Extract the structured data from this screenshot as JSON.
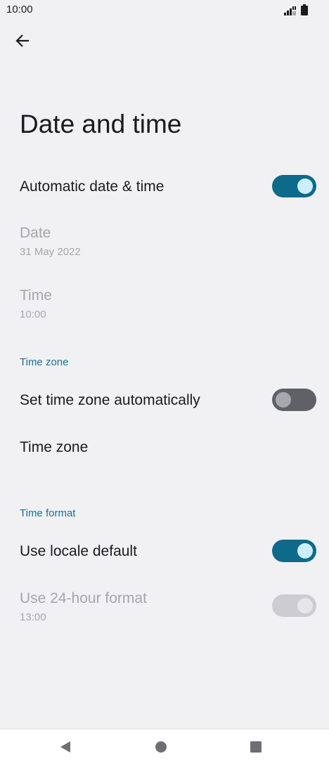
{
  "status_bar": {
    "time": "10:00",
    "icons": [
      "signal-icon",
      "battery-icon"
    ]
  },
  "header": {
    "back_icon": "arrow-left-icon",
    "title": "Date and time"
  },
  "settings": {
    "automatic_date_time": {
      "title": "Automatic date & time",
      "enabled": true
    },
    "date": {
      "title": "Date",
      "summary": "31 May 2022",
      "disabled": true
    },
    "time": {
      "title": "Time",
      "summary": "10:00",
      "disabled": true
    },
    "time_zone_section": {
      "header": "Time zone"
    },
    "set_time_zone_automatically": {
      "title": "Set time zone automatically",
      "enabled": false
    },
    "time_zone": {
      "title": "Time zone"
    },
    "time_format_section": {
      "header": "Time format"
    },
    "use_locale_default": {
      "title": "Use locale default",
      "enabled": true
    },
    "use_24_hour_format": {
      "title": "Use 24-hour format",
      "summary": "13:00",
      "enabled": true,
      "disabled": true
    }
  },
  "nav_bar": {
    "buttons": [
      "back-triangle-icon",
      "home-circle-icon",
      "recents-square-icon"
    ]
  },
  "colors": {
    "background": "#f1f1f4",
    "accent": "#0d6a8a",
    "section_header": "#1f6f8f",
    "disabled_text": "#a5a6ab"
  }
}
